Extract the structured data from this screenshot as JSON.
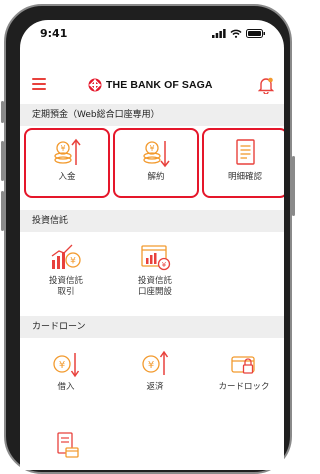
{
  "status": {
    "time": "9:41"
  },
  "header": {
    "logo_text": "THE BANK OF SAGA"
  },
  "sections": {
    "deposit": {
      "title": "定期預金（Web総合口座専用）",
      "items": [
        {
          "label": "入金"
        },
        {
          "label": "解約"
        },
        {
          "label": "明細確認"
        }
      ]
    },
    "trust": {
      "title": "投資信託",
      "items": [
        {
          "line1": "投資信託",
          "line2": "取引"
        },
        {
          "line1": "投資信託",
          "line2": "口座開設"
        }
      ]
    },
    "card": {
      "title": "カードローン",
      "items": [
        {
          "label": "借入"
        },
        {
          "label": "返済"
        },
        {
          "label": "カードロック"
        }
      ]
    }
  },
  "colors": {
    "accent": "#e8413c",
    "highlight": "#e5162a",
    "orange": "#f29a2e"
  }
}
